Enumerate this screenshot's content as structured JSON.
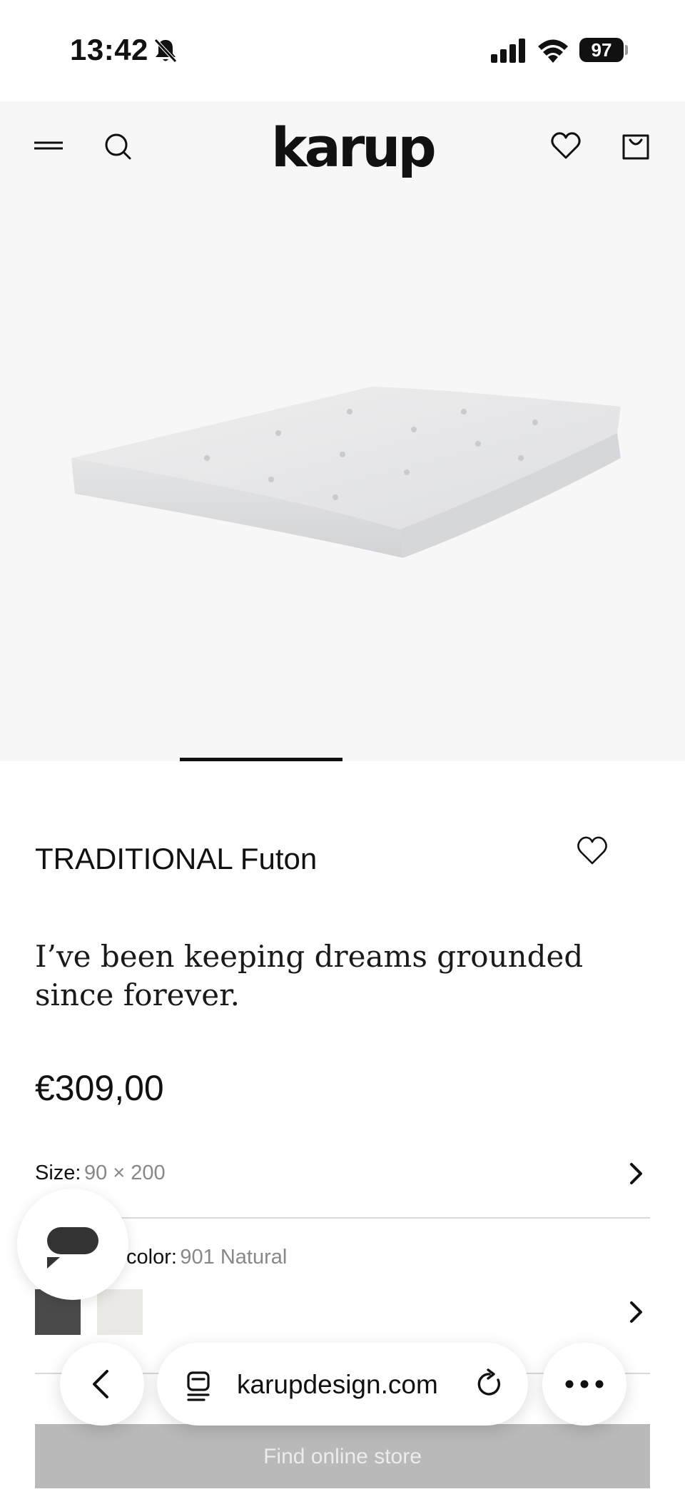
{
  "status_bar": {
    "time": "13:42",
    "battery": "97",
    "icons": [
      "bell-slash-icon",
      "cellular-signal-icon",
      "wifi-icon",
      "battery-icon"
    ]
  },
  "header": {
    "logo": "karup",
    "icons": [
      "menu-icon",
      "search-icon",
      "heart-icon",
      "bag-icon"
    ]
  },
  "product": {
    "title": "TRADITIONAL Futon",
    "tagline": "I’ve been keeping dreams grounded since forever.",
    "price": "€309,00",
    "size_label": "Size:",
    "size_value": "90 × 200",
    "color_label": "color:",
    "color_value": "901 Natural"
  },
  "buttons": {
    "find_store": "Find online store"
  },
  "browser": {
    "url": "karupdesign.com",
    "icons": [
      "back-chevron-icon",
      "tabs-icon",
      "reload-icon",
      "more-icon"
    ]
  },
  "colors": {
    "background": "#ffffff",
    "hero_background": "#f7f7f7",
    "text": "#111111",
    "muted": "#888888",
    "find_store_button": "#b9b9b9"
  }
}
